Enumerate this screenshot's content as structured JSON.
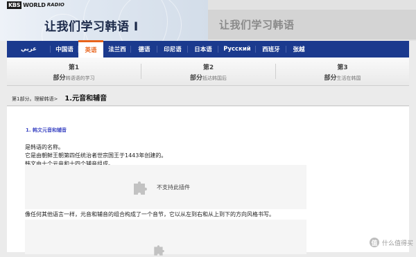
{
  "header": {
    "logo": {
      "kbs": "KBS",
      "world": "WORLD",
      "radio": "RADIO"
    },
    "title": "让我们学习韩语 I",
    "subtitle": "让我们学习韩语"
  },
  "nav": {
    "items": [
      {
        "label": "عربي",
        "active": false
      },
      {
        "label": "中国语",
        "active": false
      },
      {
        "label": "英语",
        "active": true
      },
      {
        "label": "法兰西",
        "active": false
      },
      {
        "label": "德语",
        "active": false
      },
      {
        "label": "印尼语",
        "active": false
      },
      {
        "label": "日本语",
        "active": false
      },
      {
        "label": "Русский",
        "active": false
      },
      {
        "label": "西班牙",
        "active": false
      },
      {
        "label": "张越",
        "active": false
      }
    ],
    "active_color": "#e8641c",
    "bg_color": "#1b3a8e"
  },
  "steps": [
    {
      "num": "第1",
      "part": "部分",
      "desc": "韩语语的学习"
    },
    {
      "num": "第2",
      "part": "部分",
      "desc": "抵达韩国后"
    },
    {
      "num": "第3",
      "part": "部分",
      "desc": "生活在韩国"
    }
  ],
  "breadcrumb": {
    "parent": "第1部分。理解韩语>",
    "current": "1.元音和辅音"
  },
  "content": {
    "section_title": "1. 韩文元音和辅音",
    "lines": [
      "是韩语的名称。",
      "它是由朝鲜王朝第四任统治者世宗国王于1443年创建的。",
      "韩文由十个元音和十四个辅音组成。"
    ],
    "plugin_text": "不支持此插件",
    "paragraph2": "像任何其他语言一样，元音和辅音的组合构成了一个音节，它以从左到右和从上到下的方向风格书写。"
  },
  "watermark": {
    "icon": "值",
    "text": "什么值得买"
  }
}
